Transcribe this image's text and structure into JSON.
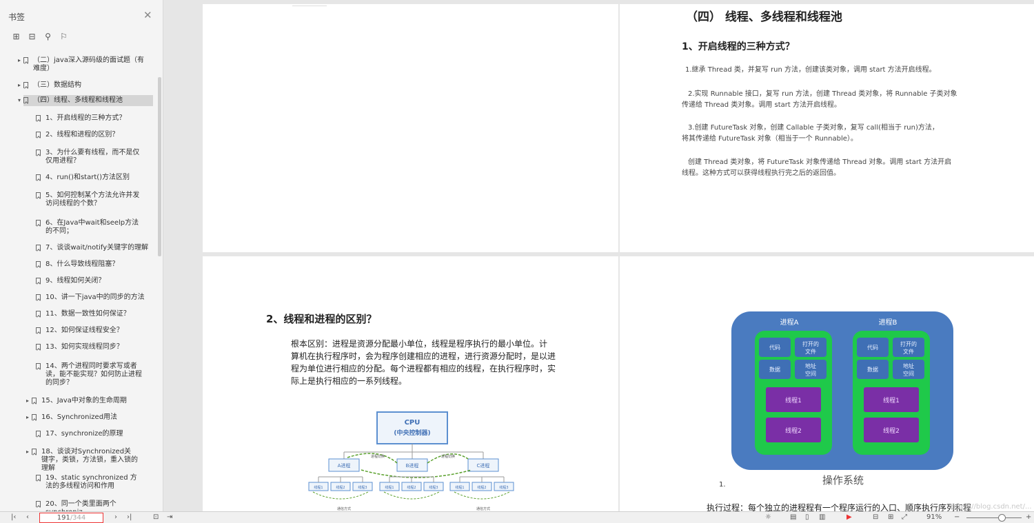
{
  "sidebar": {
    "title": "书签",
    "tools": [
      "expand-all-icon",
      "collapse-all-icon",
      "add-bookmark-icon",
      "bookmark-outline-icon"
    ],
    "items": [
      {
        "label": "（二）java深入源码级的面试题（有难度）",
        "arrow": "▸"
      },
      {
        "label": "（三）数据结构",
        "arrow": "▸"
      },
      {
        "label": "（四）线程、多线程和线程池",
        "arrow": "▾"
      },
      {
        "label": "1、开启线程的三种方式？",
        "arrow": ""
      },
      {
        "label": "2、线程和进程的区别？",
        "arrow": ""
      },
      {
        "label": "3、为什么要有线程，而不是仅仅用进程？",
        "arrow": ""
      },
      {
        "label": "4、run()和start()方法区别",
        "arrow": ""
      },
      {
        "label": "5、如何控制某个方法允许并发访问线程的个数？",
        "arrow": ""
      },
      {
        "label": "6、在Java中wait和seelp方法的不同；",
        "arrow": ""
      },
      {
        "label": "7、谈谈wait/notify关键字的理解",
        "arrow": ""
      },
      {
        "label": "8、什么导致线程阻塞？",
        "arrow": ""
      },
      {
        "label": "9、线程如何关闭？",
        "arrow": ""
      },
      {
        "label": "10、讲一下java中的同步的方法",
        "arrow": ""
      },
      {
        "label": "11、数据一致性如何保证？",
        "arrow": ""
      },
      {
        "label": "12、如何保证线程安全？",
        "arrow": ""
      },
      {
        "label": "13、如何实现线程同步？",
        "arrow": ""
      },
      {
        "label": "14、两个进程同时要求写或者读，能不能实现？如何防止进程的同步？",
        "arrow": ""
      },
      {
        "label": "15、Java中对象的生命周期",
        "arrow": "▸"
      },
      {
        "label": "16、Synchronized用法",
        "arrow": "▸"
      },
      {
        "label": "17、synchronize的原理",
        "arrow": ""
      },
      {
        "label": "18、谈谈对Synchronized关键字，类锁，方法锁，重入锁的理解",
        "arrow": "▸"
      },
      {
        "label": "19、static synchronized 方法的多线程访问和作用",
        "arrow": ""
      },
      {
        "label": "20、同一个类里面两个synchroniz",
        "arrow": ""
      }
    ]
  },
  "page2": {
    "section": "（四）  线程、多线程和线程池",
    "heading": "1、开启线程的三种方式？",
    "p1": "1.继承 Thread 类，并复写 run 方法，创建该类对象，调用 start 方法开启线程。",
    "p2a": "2.实现 Runnable 接口，复写 run 方法，创建 Thread 类对象，将 Runnable 子类对象",
    "p2b": "传递给 Thread 类对象。调用 start 方法开启线程。",
    "p3a": "3.创建 FutureTask 对象，创建 Callable 子类对象，复写 call(相当于 run)方法，",
    "p3b": "将其传递给 FutureTask 对象（相当于一个 Runnable）。",
    "p4a": "创建 Thread 类对象，将 FutureTask 对象传递给 Thread 对象。调用 start 方法开启",
    "p4b": "线程。这种方式可以获得线程执行完之后的返回值。"
  },
  "page3": {
    "heading": "2、线程和进程的区别？",
    "lines": [
      "根本区别：进程是资源分配最小单位，线程是程序执行的最小单位。计",
      "算机在执行程序时，会为程序创建相应的进程，进行资源分配时，是以进",
      "程为单位进行相应的分配。每个进程都有相应的线程，在执行程序时，实",
      "际上是执行相应的一系列线程。"
    ],
    "cpu_label": "CPU",
    "cpu_sub": "(中央控制器)",
    "processes": [
      "A进程",
      "B进程",
      "C进程"
    ],
    "threads": [
      "线程1",
      "线程2",
      "线程3"
    ],
    "switch_label": "进程切换",
    "comm_label": "通信方式"
  },
  "page4": {
    "proc_a": "进程A",
    "proc_b": "进程B",
    "code": "代码",
    "files": "打开的文件",
    "data": "数据",
    "addr": "地址空间",
    "thread1": "线程1",
    "thread2": "线程2",
    "os": "操作系统",
    "list_num": "1.",
    "bottom_text": "执行过程：每个独立的进程程有一个程序运行的入口、顺序执行序列和程"
  },
  "bottombar": {
    "page_current": "191",
    "page_total": "/344",
    "zoom": "91%",
    "watermark": "https://blog.csdn.net/..."
  },
  "colors": {
    "os_blue": "#4a7bc0",
    "proc_green": "#1fc94a",
    "thread_purple": "#7a2fa6",
    "box_blue": "#3f6fb5",
    "diagram_blue": "#5b8fd0"
  }
}
